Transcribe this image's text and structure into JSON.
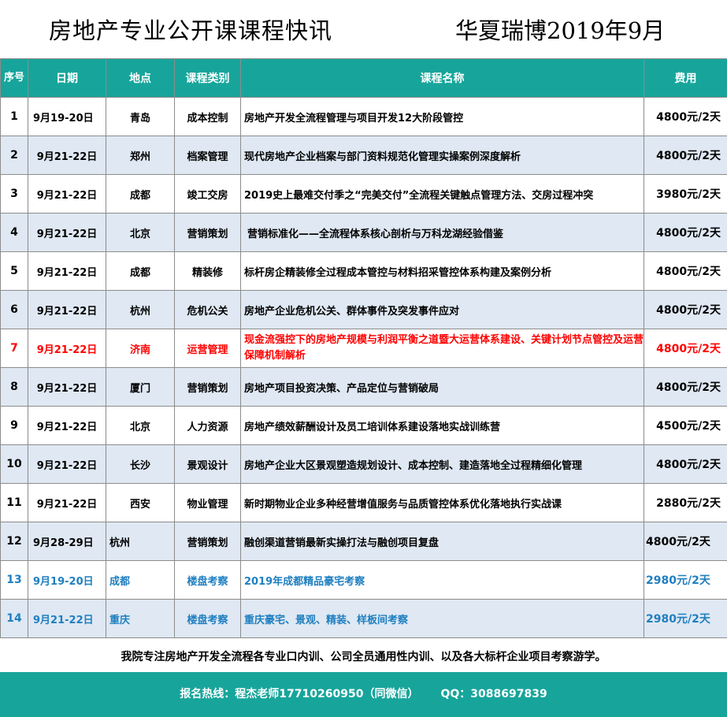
{
  "title": {
    "left": "房地产专业公开课课程快讯",
    "right": "华夏瑞博2019年9月"
  },
  "headers": {
    "seq": "序号",
    "date": "日期",
    "city": "地点",
    "type": "课程类别",
    "name": "课程名称",
    "fee": "费用"
  },
  "rows": [
    {
      "seq": "1",
      "date": "9月19-20日",
      "city": "青岛",
      "type": "成本控制",
      "name": "房地产开发全流程管理与项目开发12大阶段管控",
      "fee": "4800元/2天"
    },
    {
      "seq": "2",
      "date": "9月21-22日",
      "city": "郑州",
      "type": "档案管理",
      "name": "现代房地产企业档案与部门资料规范化管理实操案例深度解析",
      "fee": "4800元/2天"
    },
    {
      "seq": "3",
      "date": "9月21-22日",
      "city": "成都",
      "type": "竣工交房",
      "name": "2019史上最难交付季之“完美交付”全流程关键触点管理方法、交房过程冲突",
      "fee": "3980元/2天"
    },
    {
      "seq": "4",
      "date": "9月21-22日",
      "city": "北京",
      "type": "营销策划",
      "name": "营销标准化——全流程体系核心剖析与万科龙湖经验借鉴",
      "fee": "4800元/2天"
    },
    {
      "seq": "5",
      "date": "9月21-22日",
      "city": "成都",
      "type": "精装修",
      "name": "标杆房企精装修全过程成本管控与材料招采管控体系构建及案例分析",
      "fee": "4800元/2天"
    },
    {
      "seq": "6",
      "date": "9月21-22日",
      "city": "杭州",
      "type": "危机公关",
      "name": "房地产企业危机公关、群体事件及突发事件应对",
      "fee": "4800元/2天"
    },
    {
      "seq": "7",
      "date": "9月21-22日",
      "city": "济南",
      "type": "运营管理",
      "name": "现金流强控下的房地产规模与利润平衡之道暨大运营体系建设、关键计划节点管控及运营保障机制解析",
      "fee": "4800元/2天"
    },
    {
      "seq": "8",
      "date": "9月21-22日",
      "city": "厦门",
      "type": "营销策划",
      "name": "房地产项目投资决策、产品定位与营销破局",
      "fee": "4800元/2天"
    },
    {
      "seq": "9",
      "date": "9月21-22日",
      "city": "北京",
      "type": "人力资源",
      "name": "房地产绩效薪酬设计及员工培训体系建设落地实战训练营",
      "fee": "4500元/2天"
    },
    {
      "seq": "10",
      "date": "9月21-22日",
      "city": "长沙",
      "type": "景观设计",
      "name": "房地产企业大区景观塑造规划设计、成本控制、建造落地全过程精细化管理",
      "fee": "4800元/2天"
    },
    {
      "seq": "11",
      "date": "9月21-22日",
      "city": "西安",
      "type": "物业管理",
      "name": "新时期物业企业多种经营增值服务与品质管控体系优化落地执行实战课",
      "fee": "2880元/2天"
    },
    {
      "seq": "12",
      "date": "9月28-29日",
      "city": "杭州",
      "type": "营销策划",
      "name": "融创渠道营销最新实操打法与融创项目复盘",
      "fee": "4800元/2天"
    },
    {
      "seq": "13",
      "date": "9月19-20日",
      "city": "成都",
      "type": "楼盘考察",
      "name": "2019年成都精品豪宅考察",
      "fee": "2980元/2天"
    },
    {
      "seq": "14",
      "date": "9月21-22日",
      "city": "重庆",
      "type": "楼盘考察",
      "name": "重庆豪宅、景观、精装、样板间考察",
      "fee": "2980元/2天"
    }
  ],
  "note": "我院专注房地产开发全流程各专业口内训、公司全员通用性内训、以及各大标杆企业项目考察游学。",
  "footer": {
    "hotline": "报名热线：程杰老师17710260950（同微信）",
    "qq": "QQ：3088697839"
  },
  "colors": {
    "header_bg": "#17a59b",
    "row_alt_bg": "#dfe8f3",
    "highlight_red": "#ff0000",
    "highlight_blue": "#1f7fc0"
  }
}
